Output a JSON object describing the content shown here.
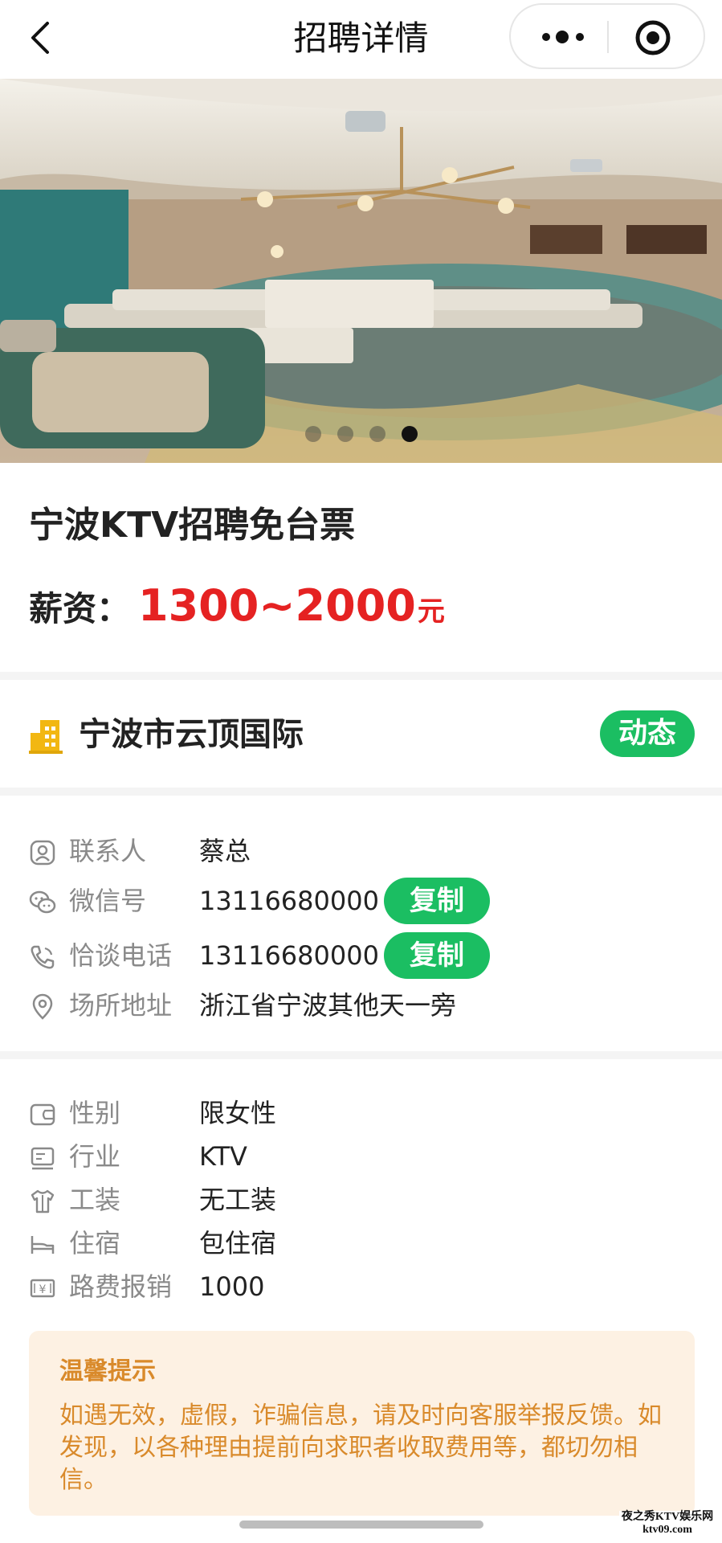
{
  "navbar": {
    "title": "招聘详情"
  },
  "hero": {
    "slide_count": 4,
    "active_index": 3
  },
  "job": {
    "title": "宁波KTV招聘免台票",
    "salary_label": "薪资：",
    "salary_value": "1300~2000",
    "salary_unit": "元"
  },
  "company": {
    "name": "宁波市云顶国际",
    "badge": "动态"
  },
  "contact": [
    {
      "icon": "contact-person-icon",
      "label": "联系人",
      "value": "蔡总"
    },
    {
      "icon": "wechat-icon",
      "label": "微信号",
      "value": "13116680000",
      "button": "复制"
    },
    {
      "icon": "phone-icon",
      "label": "恰谈电话",
      "value": "13116680000",
      "button": "复制"
    },
    {
      "icon": "location-icon",
      "label": "场所地址",
      "value": "浙江省宁波其他天一旁"
    }
  ],
  "details": [
    {
      "icon": "gender-icon",
      "label": "性别",
      "value": "限女性"
    },
    {
      "icon": "industry-icon",
      "label": "行业",
      "value": "KTV"
    },
    {
      "icon": "uniform-icon",
      "label": "工装",
      "value": "无工装"
    },
    {
      "icon": "bed-icon",
      "label": "住宿",
      "value": "包住宿"
    },
    {
      "icon": "money-icon",
      "label": "路费报销",
      "value": "1000"
    }
  ],
  "notice": {
    "title": "温馨提示",
    "body": "如遇无效，虚假，诈骗信息，请及时向客服举报反馈。如发现，以各种理由提前向求职者收取费用等，都切勿相信。"
  },
  "watermark": {
    "line1": "夜之秀KTV娱乐网",
    "line2": "ktv09.com"
  },
  "colors": {
    "accent_green": "#1bbe62",
    "salary_red": "#e52222",
    "notice_text": "#d98a2b",
    "notice_bg": "#fdf1e3"
  }
}
